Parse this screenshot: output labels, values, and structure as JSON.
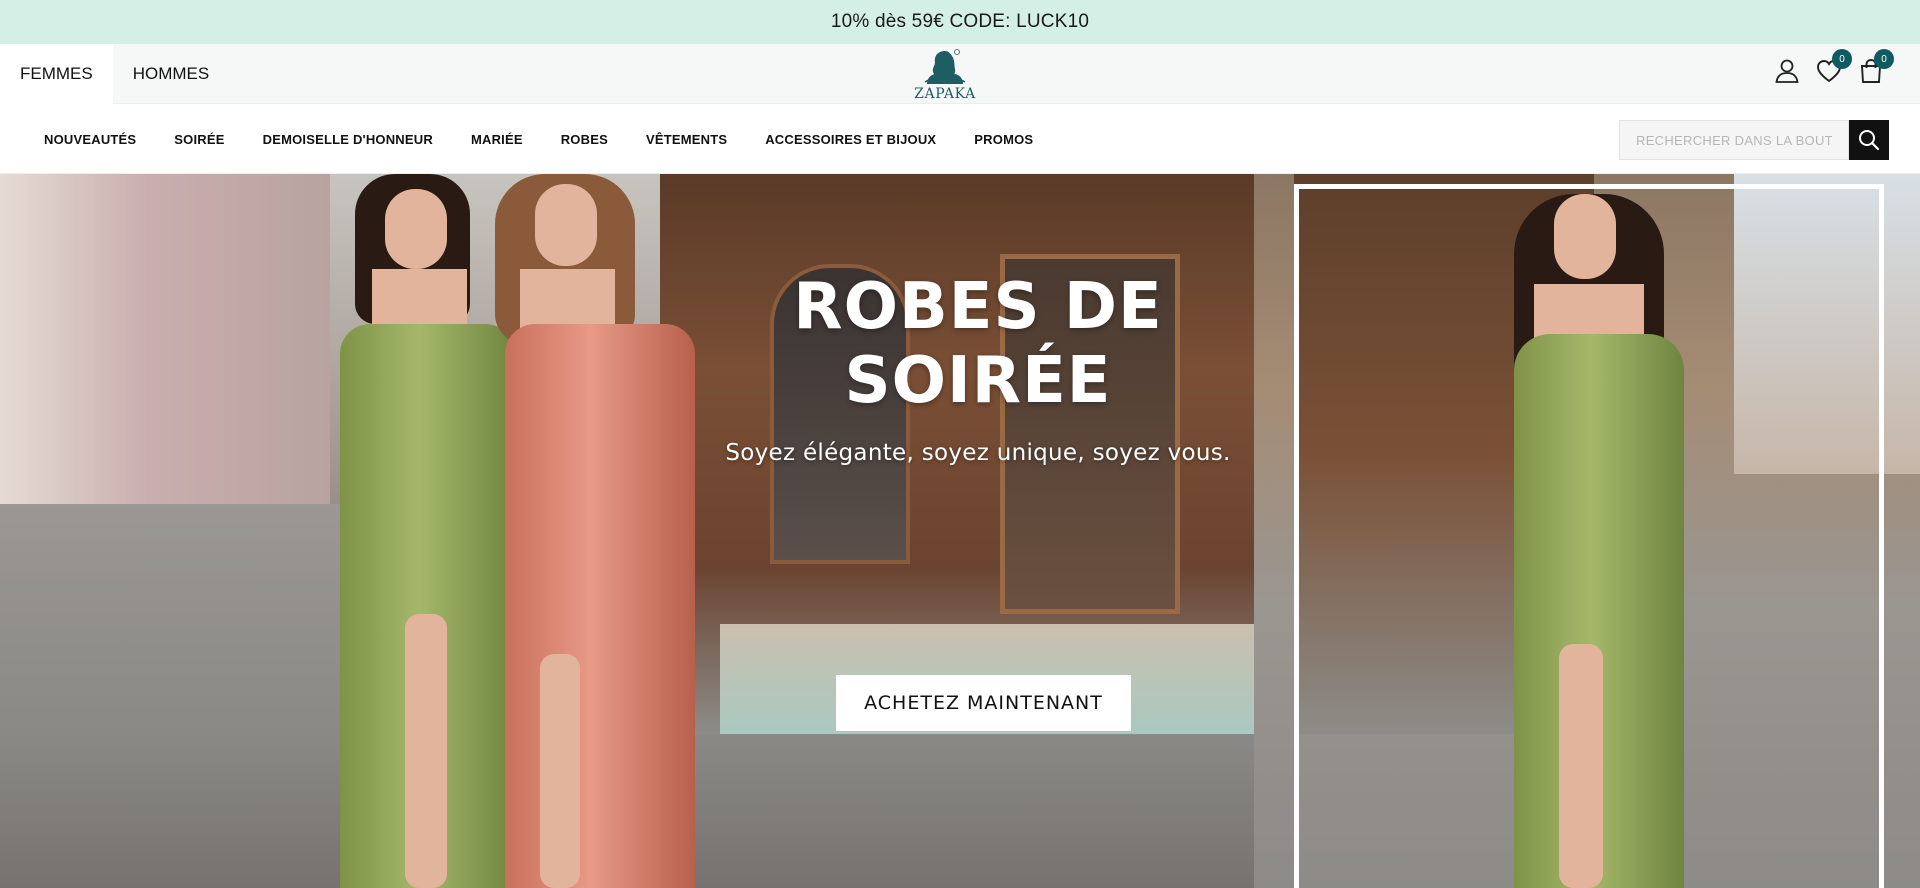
{
  "announcement": {
    "text": "10% dès 59€ CODE: LUCK10"
  },
  "header": {
    "tabs": [
      {
        "label": "FEMMES",
        "active": true
      },
      {
        "label": "HOMMES",
        "active": false
      }
    ],
    "logo_text": "ZAPAKA",
    "icons": {
      "account": "user-icon",
      "wishlist": "heart-icon",
      "wishlist_count": "0",
      "cart": "shopping-bag-icon",
      "cart_count": "0"
    },
    "accent_color": "#0f5b62"
  },
  "nav": {
    "items": [
      {
        "label": "NOUVEAUTÉS"
      },
      {
        "label": "SOIRÉE"
      },
      {
        "label": "DEMOISELLE D'HONNEUR"
      },
      {
        "label": "MARIÉE"
      },
      {
        "label": "ROBES"
      },
      {
        "label": "VÊTEMENTS"
      },
      {
        "label": "ACCESSOIRES ET BIJOUX"
      },
      {
        "label": "PROMOS"
      }
    ],
    "search": {
      "placeholder": "RECHERCHER DANS LA BOUTIQUE",
      "button_icon": "search-icon"
    }
  },
  "hero": {
    "title": "ROBES DE SOIRÉE",
    "subtitle": "Soyez élégante, soyez unique, soyez vous.",
    "cta_label": "ACHETEZ MAINTENANT"
  },
  "colors": {
    "announcement_bg": "#d4efe6",
    "cta_bg": "#ffffff",
    "search_button_bg": "#111111"
  }
}
